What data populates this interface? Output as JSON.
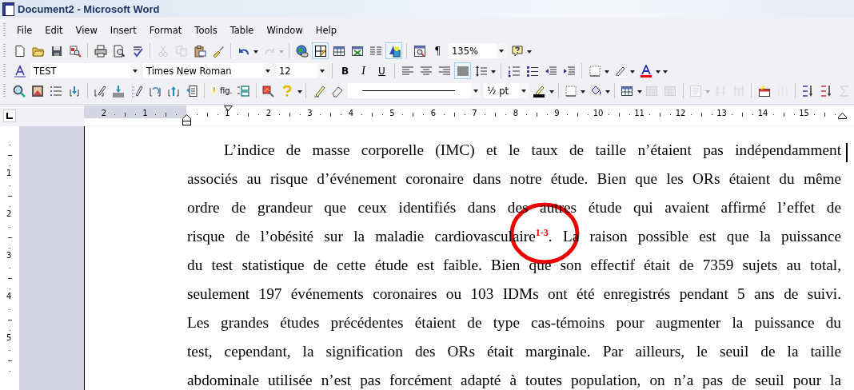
{
  "window": {
    "title": "Document2 - Microsoft Word"
  },
  "menu": [
    {
      "label": "File"
    },
    {
      "label": "Edit"
    },
    {
      "label": "View"
    },
    {
      "label": "Insert"
    },
    {
      "label": "Format"
    },
    {
      "label": "Tools"
    },
    {
      "label": "Table"
    },
    {
      "label": "Window"
    },
    {
      "label": "Help"
    }
  ],
  "toolbars": [
    {
      "items": [
        {
          "kind": "button",
          "pressed": false,
          "disabled": false
        },
        {
          "kind": "button",
          "pressed": false,
          "disabled": false
        },
        {
          "kind": "button",
          "pressed": false,
          "disabled": false
        },
        {
          "kind": "button",
          "pressed": false,
          "disabled": false
        },
        {
          "kind": "separator"
        },
        {
          "kind": "button",
          "pressed": false,
          "disabled": false
        },
        {
          "kind": "button",
          "pressed": false,
          "disabled": false
        },
        {
          "kind": "button",
          "pressed": false,
          "disabled": false
        },
        {
          "kind": "separator"
        },
        {
          "kind": "button",
          "pressed": false,
          "disabled": true
        },
        {
          "kind": "button",
          "pressed": false,
          "disabled": true
        },
        {
          "kind": "button",
          "pressed": false,
          "disabled": false
        },
        {
          "kind": "button",
          "pressed": false,
          "disabled": false
        },
        {
          "kind": "separator"
        },
        {
          "kind": "button",
          "pressed": false,
          "disabled": false
        },
        {
          "kind": "arrow",
          "disabled": false
        },
        {
          "kind": "button",
          "pressed": false,
          "disabled": true
        },
        {
          "kind": "arrow",
          "disabled": true
        },
        {
          "kind": "separator"
        },
        {
          "kind": "button",
          "pressed": false,
          "disabled": false
        },
        {
          "kind": "button",
          "pressed": true,
          "disabled": false
        },
        {
          "kind": "button",
          "pressed": false,
          "disabled": false
        },
        {
          "kind": "button",
          "pressed": false,
          "disabled": false
        },
        {
          "kind": "button",
          "pressed": false,
          "disabled": false
        },
        {
          "kind": "button",
          "pressed": true,
          "disabled": false
        },
        {
          "kind": "separator"
        },
        {
          "kind": "button",
          "pressed": false,
          "disabled": false
        },
        {
          "kind": "button",
          "pressed": false,
          "disabled": false,
          "label": "¶"
        },
        {
          "kind": "combo",
          "value": "135%"
        },
        {
          "kind": "button",
          "pressed": false,
          "disabled": false
        },
        {
          "kind": "arrow",
          "disabled": false
        }
      ]
    },
    {
      "items": [
        {
          "kind": "button",
          "pressed": false,
          "disabled": false
        },
        {
          "kind": "combo",
          "value": "TEST"
        },
        {
          "kind": "combo",
          "value": "Times New Roman"
        },
        {
          "kind": "combo",
          "value": "12"
        },
        {
          "kind": "separator"
        },
        {
          "kind": "button",
          "pressed": false,
          "disabled": false,
          "label": "B"
        },
        {
          "kind": "button",
          "pressed": false,
          "disabled": false,
          "label": "I"
        },
        {
          "kind": "button",
          "pressed": false,
          "disabled": false,
          "label": "U"
        },
        {
          "kind": "separator"
        },
        {
          "kind": "button",
          "pressed": false,
          "disabled": false
        },
        {
          "kind": "button",
          "pressed": false,
          "disabled": false
        },
        {
          "kind": "button",
          "pressed": false,
          "disabled": false
        },
        {
          "kind": "button",
          "pressed": true,
          "disabled": false
        },
        {
          "kind": "button",
          "pressed": false,
          "disabled": false
        },
        {
          "kind": "arrow",
          "disabled": false
        },
        {
          "kind": "separator"
        },
        {
          "kind": "button",
          "pressed": false,
          "disabled": false
        },
        {
          "kind": "button",
          "pressed": false,
          "disabled": false
        },
        {
          "kind": "button",
          "pressed": false,
          "disabled": false
        },
        {
          "kind": "button",
          "pressed": false,
          "disabled": false
        },
        {
          "kind": "separator"
        },
        {
          "kind": "button",
          "pressed": false,
          "disabled": false
        },
        {
          "kind": "arrow",
          "disabled": false
        },
        {
          "kind": "button",
          "pressed": false,
          "disabled": false
        },
        {
          "kind": "arrow",
          "disabled": false
        },
        {
          "kind": "button",
          "pressed": false,
          "disabled": false
        },
        {
          "kind": "arrow",
          "disabled": false
        },
        {
          "kind": "arrow",
          "disabled": false
        }
      ]
    },
    {
      "items": [
        {
          "kind": "button",
          "pressed": false,
          "disabled": false
        },
        {
          "kind": "button",
          "pressed": false,
          "disabled": false
        },
        {
          "kind": "button",
          "pressed": false,
          "disabled": false
        },
        {
          "kind": "button",
          "pressed": false,
          "disabled": false
        },
        {
          "kind": "separator"
        },
        {
          "kind": "button",
          "pressed": false,
          "disabled": false
        },
        {
          "kind": "button",
          "pressed": false,
          "disabled": false
        },
        {
          "kind": "button",
          "pressed": false,
          "disabled": false
        },
        {
          "kind": "button",
          "pressed": false,
          "disabled": false
        },
        {
          "kind": "button",
          "pressed": false,
          "disabled": false
        },
        {
          "kind": "button",
          "pressed": false,
          "disabled": false
        },
        {
          "kind": "separator"
        },
        {
          "kind": "button",
          "pressed": false,
          "disabled": false,
          "label": "fig."
        },
        {
          "kind": "button",
          "pressed": false,
          "disabled": false
        },
        {
          "kind": "separator"
        },
        {
          "kind": "button",
          "pressed": false,
          "disabled": false
        },
        {
          "kind": "button",
          "pressed": false,
          "disabled": false
        },
        {
          "kind": "arrow",
          "disabled": false
        },
        {
          "kind": "separator"
        },
        {
          "kind": "button",
          "pressed": false,
          "disabled": false
        },
        {
          "kind": "button",
          "pressed": false,
          "disabled": false
        },
        {
          "kind": "line-combo"
        },
        {
          "kind": "combo",
          "value": "½ pt"
        },
        {
          "kind": "button",
          "pressed": false,
          "disabled": false
        },
        {
          "kind": "arrow",
          "disabled": false
        },
        {
          "kind": "separator"
        },
        {
          "kind": "button",
          "pressed": false,
          "disabled": false
        },
        {
          "kind": "arrow",
          "disabled": false
        },
        {
          "kind": "button",
          "pressed": false,
          "disabled": false
        },
        {
          "kind": "arrow",
          "disabled": false
        },
        {
          "kind": "separator"
        },
        {
          "kind": "button",
          "pressed": false,
          "disabled": false
        },
        {
          "kind": "arrow",
          "disabled": false
        },
        {
          "kind": "button",
          "pressed": false,
          "disabled": true
        },
        {
          "kind": "button",
          "pressed": false,
          "disabled": true
        },
        {
          "kind": "separator"
        },
        {
          "kind": "button",
          "pressed": false,
          "disabled": true
        },
        {
          "kind": "arrow",
          "disabled": true
        },
        {
          "kind": "button",
          "pressed": false,
          "disabled": true
        },
        {
          "kind": "button",
          "pressed": false,
          "disabled": true
        },
        {
          "kind": "separator"
        },
        {
          "kind": "button",
          "pressed": false,
          "disabled": false
        },
        {
          "kind": "button",
          "pressed": false,
          "disabled": true
        },
        {
          "kind": "separator"
        },
        {
          "kind": "button",
          "pressed": false,
          "disabled": false
        },
        {
          "kind": "button",
          "pressed": false,
          "disabled": false
        },
        {
          "kind": "button",
          "pressed": false,
          "disabled": true
        }
      ]
    }
  ],
  "ruler": {
    "left_numbers": [
      "2",
      "1"
    ],
    "numbers": [
      "1",
      "2",
      "3",
      "4",
      "5",
      "6",
      "7",
      "8",
      "9",
      "10",
      "11",
      "12",
      "13",
      "14",
      "15"
    ]
  },
  "vertical_ruler": {
    "numbers": [
      "1",
      "2",
      "3",
      "4",
      "5"
    ]
  },
  "document": {
    "lines": [
      "L’indice de masse corporelle (IMC) et le taux de taille n’étaient pas indépendamment",
      "associés au risque d’événement coronaire dans notre étude. Bien que les ORs étaient du même",
      "ordre de grandeur que ceux identifiés dans des autres étude qui avaient affirmé l’effet de",
      "risque de l’obésité sur la maladie cardiovasculaire$^{1-3}$. La raison possible est que la puissance",
      "du test statistique de cette étude est faible. Bien que son effectif était de 7359 sujets au total,",
      "seulement 197 événements coronaires ou 103 IDMs ont été enregistrés pendant 5 ans de suivi.",
      "Les grandes études précédentes étaient de type cas-témoins pour augmenter la puissance du",
      "test, cependant, la signification des ORs était marginale. Par ailleurs, le seuil de la taille",
      "abdominale utilisée n’est pas forcément adapté à toutes population, on n’a pas de seuil pour la"
    ]
  }
}
